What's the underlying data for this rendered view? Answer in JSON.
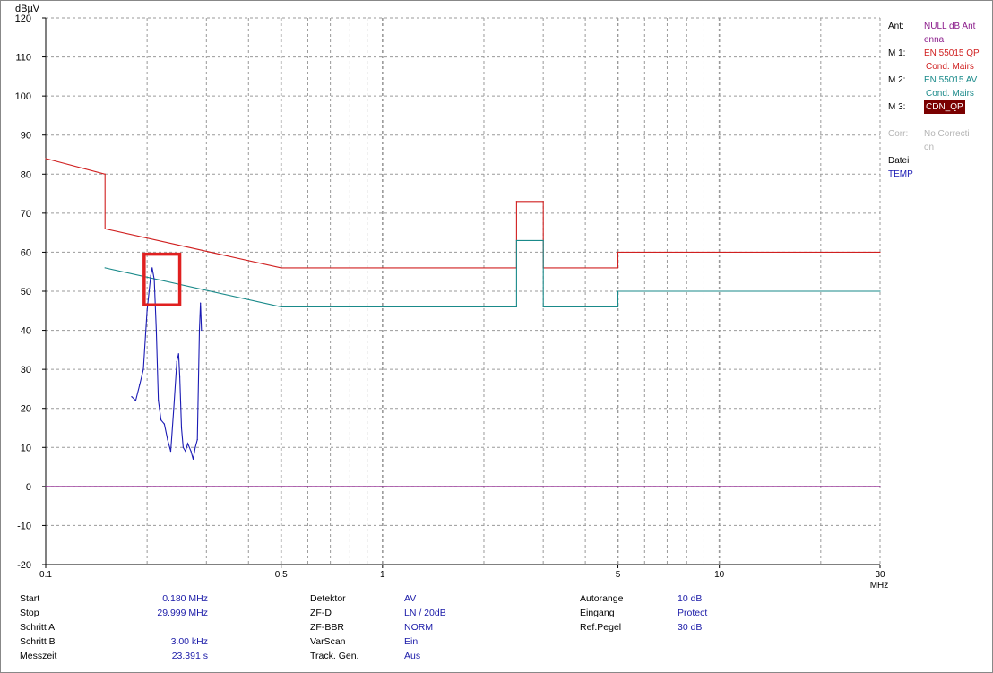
{
  "chart_data": {
    "type": "line",
    "ylabel": "dBµV",
    "xlabel": "MHz",
    "x_scale": "log",
    "xlim": [
      0.1,
      30
    ],
    "ylim": [
      -20,
      120
    ],
    "x_tick_labels": [
      "0.1",
      "0.5",
      "1",
      "5",
      "10",
      "30"
    ],
    "y_tick_labels": [
      "120",
      "110",
      "100",
      "90",
      "80",
      "70",
      "60",
      "50",
      "40",
      "30",
      "20",
      "10",
      "0",
      "-10",
      "-20"
    ],
    "grid": true,
    "series": [
      {
        "name": "EN 55015 QP Cond. Mairs",
        "color": "#d02020",
        "x": [
          0.1,
          0.15,
          0.15,
          0.5,
          2.5,
          2.5,
          3.0,
          3.0,
          5.0,
          5.0,
          30.0
        ],
        "y": [
          84,
          80,
          66,
          56,
          56,
          73,
          73,
          56,
          56,
          60,
          60
        ]
      },
      {
        "name": "EN 55015 AV Cond. Mairs",
        "color": "#1a8a8a",
        "x": [
          0.15,
          0.5,
          2.5,
          2.5,
          3.0,
          3.0,
          5.0,
          5.0,
          30.0
        ],
        "y": [
          56,
          46,
          46,
          63,
          63,
          46,
          46,
          50,
          50
        ]
      },
      {
        "name": "NULL dB Antenna",
        "color": "#8a1a8a",
        "x": [
          0.1,
          30.0
        ],
        "y": [
          0,
          0
        ]
      },
      {
        "name": "TEMP",
        "color": "#1a1ab4",
        "x": [
          0.18,
          0.185,
          0.19,
          0.195,
          0.2,
          0.205,
          0.207,
          0.21,
          0.213,
          0.216,
          0.22,
          0.225,
          0.23,
          0.235,
          0.24,
          0.245,
          0.248,
          0.25,
          0.253,
          0.256,
          0.26,
          0.264,
          0.27,
          0.274,
          0.278,
          0.282,
          0.286,
          0.288,
          0.29
        ],
        "y": [
          23,
          22,
          26,
          30,
          45,
          54,
          56,
          53,
          40,
          22,
          17,
          16,
          12,
          9,
          20,
          32,
          34,
          28,
          15,
          10,
          9,
          11,
          9,
          7,
          10,
          12,
          40,
          47,
          40
        ]
      }
    ],
    "highlight_box": {
      "x_range": [
        0.196,
        0.25
      ],
      "y_range": [
        46.5,
        59.5
      ],
      "color": "#e02020"
    }
  },
  "legend": {
    "ant_label": "Ant:",
    "ant_value_1": "NULL dB Ant",
    "ant_value_2": "enna",
    "m1_label": "M 1:",
    "m1_value_1": "EN 55015 QP",
    "m1_value_2": "Cond. Mairs",
    "m2_label": "M 2:",
    "m2_value_1": "EN 55015 AV",
    "m2_value_2": "Cond. Mairs",
    "m3_label": "M 3:",
    "m3_value": "CDN_QP",
    "corr_label": "Corr:",
    "corr_value_1": "No Correcti",
    "corr_value_2": "on",
    "datei_label": "Datei",
    "datei_value": "TEMP",
    "colors": {
      "ant": "#8a1a8a",
      "m1": "#d02020",
      "m2": "#1a8a8a",
      "m3_bg": "#7a0000",
      "corr": "#b4b4b4",
      "datei": "#1a1ab4"
    }
  },
  "params": {
    "col1": [
      {
        "label": "Start",
        "value": "0.180 MHz"
      },
      {
        "label": "Stop",
        "value": "29.999 MHz"
      },
      {
        "label": "Schritt A",
        "value": ""
      },
      {
        "label": "Schritt B",
        "value": "3.00 kHz"
      },
      {
        "label": "Messzeit",
        "value": "23.391 s"
      }
    ],
    "col2": [
      {
        "label": "Detektor",
        "value": "AV"
      },
      {
        "label": "ZF-D",
        "value": "LN / 20dB"
      },
      {
        "label": "ZF-BBR",
        "value": "NORM"
      },
      {
        "label": "VarScan",
        "value": "Ein"
      },
      {
        "label": "Track. Gen.",
        "value": "Aus"
      }
    ],
    "col3": [
      {
        "label": "Autorange",
        "value": "10 dB"
      },
      {
        "label": "Eingang",
        "value": "Protect"
      },
      {
        "label": "Ref.Pegel",
        "value": "30 dB"
      }
    ]
  }
}
